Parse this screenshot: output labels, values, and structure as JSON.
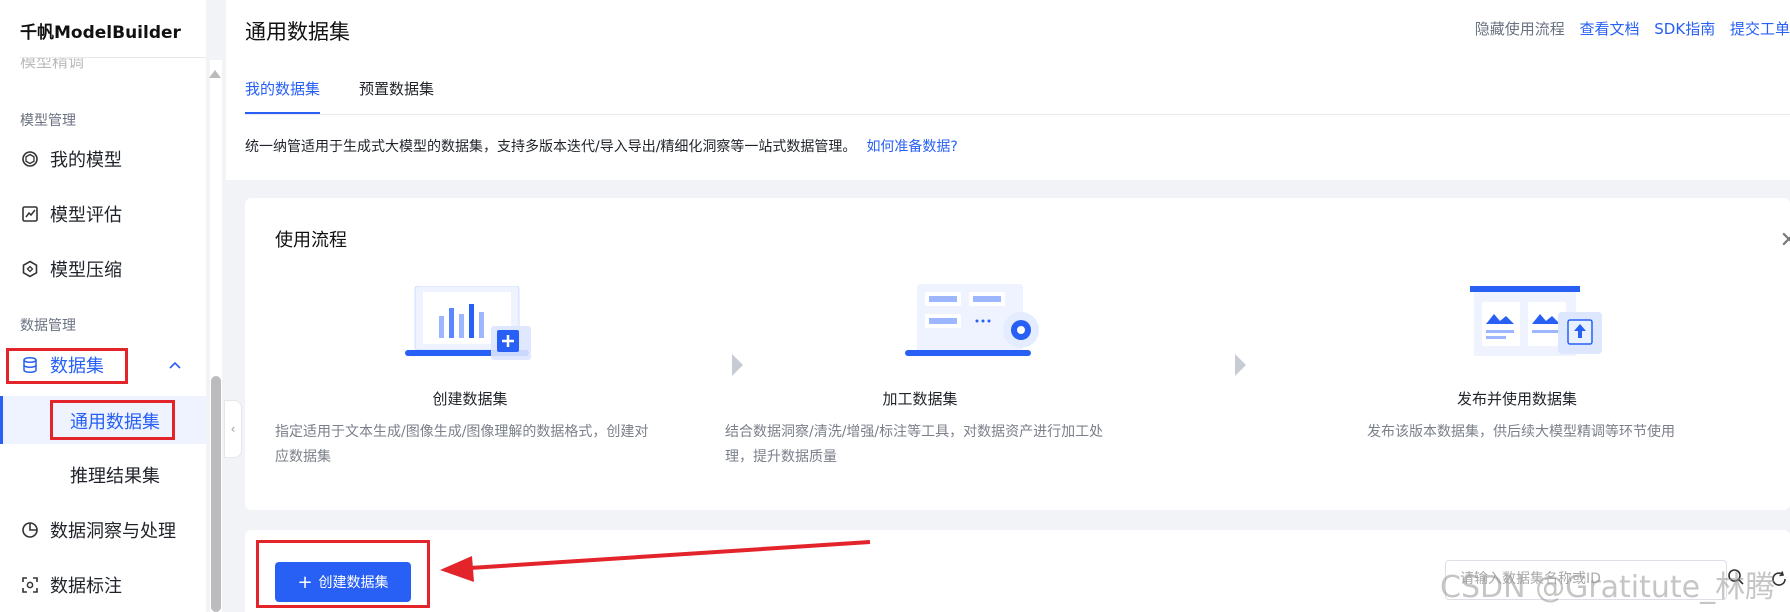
{
  "sidebar": {
    "brand": "千帆ModelBuilder",
    "cut_item": "模型精调",
    "groups": [
      {
        "label": "模型管理"
      },
      {
        "label": "数据管理"
      }
    ],
    "items": [
      {
        "label": "我的模型",
        "icon": "model-cube-icon"
      },
      {
        "label": "模型评估",
        "icon": "evaluate-chart-icon"
      },
      {
        "label": "模型压缩",
        "icon": "compress-hex-icon"
      },
      {
        "label": "数据集",
        "icon": "database-icon"
      },
      {
        "label": "数据洞察与处理",
        "icon": "pie-chart-icon"
      },
      {
        "label": "数据标注",
        "icon": "annotate-scan-icon"
      }
    ],
    "sub_items": [
      {
        "label": "通用数据集"
      },
      {
        "label": "推理结果集"
      }
    ]
  },
  "header": {
    "title": "通用数据集",
    "links": [
      {
        "label": "隐藏使用流程"
      },
      {
        "label": "查看文档"
      },
      {
        "label": "SDK指南"
      },
      {
        "label": "提交工单"
      }
    ],
    "tabs": [
      {
        "label": "我的数据集"
      },
      {
        "label": "预置数据集"
      }
    ],
    "description": "统一纳管适用于生成式大模型的数据集，支持多版本迭代/导入导出/精细化洞察等一站式数据管理。",
    "description_link": "如何准备数据?"
  },
  "flow": {
    "title": "使用流程",
    "steps": [
      {
        "name": "创建数据集",
        "desc_line1": "指定适用于文本生成/图像生成/图像理解的数据格式，创建对",
        "desc_line2": "应数据集"
      },
      {
        "name": "加工数据集",
        "desc_line1": "结合数据洞察/清洗/增强/标注等工具，对数据资产进行加工处",
        "desc_line2": "理，提升数据质量"
      },
      {
        "name": "发布并使用数据集",
        "desc_line1": "发布该版本数据集，供后续大模型精调等环节使用",
        "desc_line2": ""
      }
    ]
  },
  "actions": {
    "create_button": "创建数据集",
    "search_placeholder": "请输入数据集名称或ID"
  },
  "watermark": "CSDN @Gratitute_林腾",
  "colors": {
    "accent": "#2860f5",
    "annotation_red": "#e3242b"
  }
}
